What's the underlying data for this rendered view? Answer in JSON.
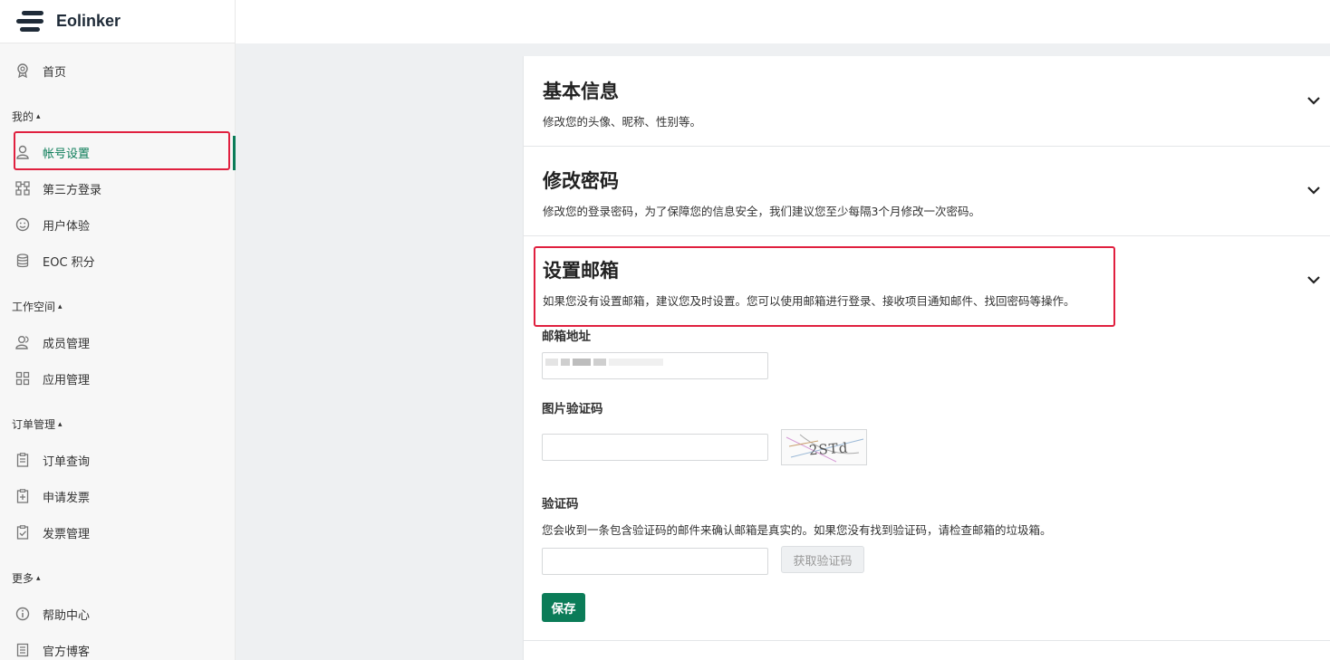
{
  "brand": {
    "name": "Eolinker"
  },
  "sidebar": {
    "home": {
      "label": "首页",
      "icon": "award-icon"
    },
    "sections": [
      {
        "label": "我的",
        "caret": "^"
      },
      {
        "label": "工作空间",
        "caret": "^"
      },
      {
        "label": "订单管理",
        "caret": "^"
      },
      {
        "label": "更多",
        "caret": "^"
      }
    ],
    "items": [
      {
        "label": "帐号设置",
        "icon": "user-icon",
        "active": true
      },
      {
        "label": "第三方登录",
        "icon": "link-icon"
      },
      {
        "label": "用户体验",
        "icon": "smile-icon"
      },
      {
        "label": "EOC 积分",
        "icon": "database-icon"
      },
      {
        "label": "成员管理",
        "icon": "members-icon"
      },
      {
        "label": "应用管理",
        "icon": "apps-icon"
      },
      {
        "label": "订单查询",
        "icon": "clipboard-icon"
      },
      {
        "label": "申请发票",
        "icon": "clipboard-plus-icon"
      },
      {
        "label": "发票管理",
        "icon": "clipboard-check-icon"
      },
      {
        "label": "帮助中心",
        "icon": "info-icon"
      },
      {
        "label": "官方博客",
        "icon": "list-icon"
      }
    ]
  },
  "main": {
    "basic_info": {
      "title": "基本信息",
      "desc": "修改您的头像、昵称、性别等。"
    },
    "password": {
      "title": "修改密码",
      "desc": "修改您的登录密码，为了保障您的信息安全，我们建议您至少每隔3个月修改一次密码。"
    },
    "email": {
      "title": "设置邮箱",
      "desc": "如果您没有设置邮箱，建议您及时设置。您可以使用邮箱进行登录、接收项目通知邮件、找回密码等操作。",
      "address_label": "邮箱地址",
      "captcha_label": "图片验证码",
      "captcha_text": "2STd",
      "code_label": "验证码",
      "code_desc": "您会收到一条包含验证码的邮件来确认邮箱是真实的。如果您没有找到验证码，请检查邮箱的垃圾箱。",
      "get_code_button": "获取验证码",
      "save_button": "保存"
    }
  },
  "colors": {
    "accent": "#0b7c58",
    "highlight": "#e0203f"
  }
}
